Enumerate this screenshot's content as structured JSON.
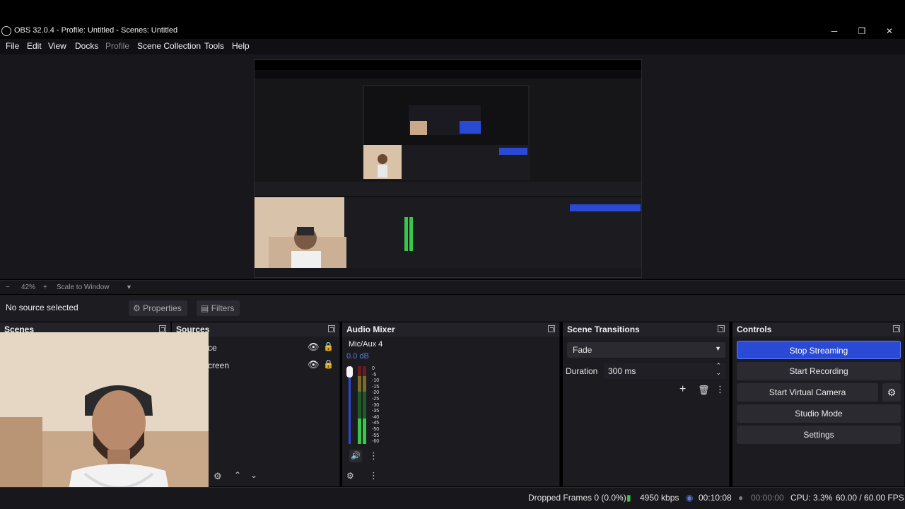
{
  "window": {
    "title": "OBS 32.0.4 - Profile: Untitled - Scenes: Untitled"
  },
  "menu": [
    "File",
    "Edit",
    "View",
    "Docks",
    "Profile",
    "Scene Collection",
    "Tools",
    "Help"
  ],
  "zoom": {
    "minus": "−",
    "value": "42%",
    "plus": "+",
    "mode": "Scale to Window"
  },
  "source_bar": {
    "status": "No source selected",
    "properties": "Properties",
    "filters": "Filters"
  },
  "docks": {
    "scenes": {
      "title": "Scenes"
    },
    "sources": {
      "title": "Sources",
      "items": [
        {
          "label": "ce"
        },
        {
          "label": "creen"
        }
      ]
    },
    "audio": {
      "title": "Audio Mixer",
      "channel": "Mic/Aux 4",
      "db": "0.0 dB",
      "scale": [
        "0",
        "-5",
        "-10",
        "-15",
        "-20",
        "-25",
        "-30",
        "-35",
        "-40",
        "-45",
        "-50",
        "-55",
        "-60"
      ]
    },
    "transitions": {
      "title": "Scene Transitions",
      "selected": "Fade",
      "duration_label": "Duration",
      "duration_value": "300 ms"
    },
    "controls": {
      "title": "Controls",
      "buttons": [
        "Stop Streaming",
        "Start Recording",
        "Start Virtual Camera",
        "Studio Mode",
        "Settings"
      ]
    }
  },
  "status": {
    "dropped": "Dropped Frames 0 (0.0%)",
    "bitrate": "4950 kbps",
    "stream_time": "00:10:08",
    "rec_time": "00:00:00",
    "cpu": "CPU: 3.3%",
    "fps": "60.00 / 60.00 FPS"
  },
  "colors": {
    "accent": "#2a4ad6",
    "meter_green": "#37c84a",
    "meter_yellow": "#c9b23a",
    "meter_red": "#b3262e"
  }
}
